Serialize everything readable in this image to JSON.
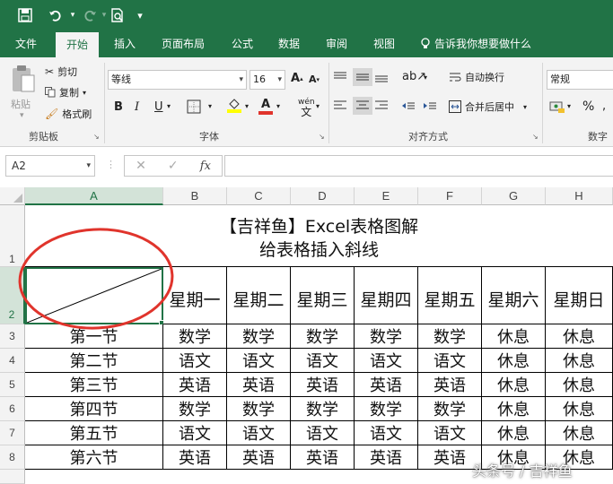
{
  "quick_access": {
    "save_icon": "save-icon",
    "undo_icon": "undo-icon",
    "redo_icon": "redo-icon",
    "preview_icon": "print-preview-icon",
    "customize_icon": "customize-quick-access-icon"
  },
  "tabs": [
    "文件",
    "开始",
    "插入",
    "页面布局",
    "公式",
    "数据",
    "审阅",
    "视图"
  ],
  "tell_me": "告诉我你想要做什么",
  "ribbon": {
    "clipboard": {
      "paste": "粘贴",
      "cut": "剪切",
      "copy": "复制",
      "format_painter": "格式刷",
      "group_label": "剪贴板"
    },
    "font": {
      "font_name": "等线",
      "font_size": "16",
      "bold": "B",
      "italic": "I",
      "underline": "U",
      "phonetic": "wén",
      "group_label": "字体"
    },
    "alignment": {
      "wrap_text": "自动换行",
      "merge_center": "合并后居中",
      "group_label": "对齐方式"
    },
    "number": {
      "format": "常规",
      "percent": "%",
      "group_label": "数字"
    }
  },
  "formula_bar": {
    "name_box": "A2",
    "fx": "fx",
    "content": ""
  },
  "grid": {
    "columns": [
      "A",
      "B",
      "C",
      "D",
      "E",
      "F",
      "G",
      "H"
    ],
    "rows": [
      "1",
      "2",
      "3",
      "4",
      "5",
      "6",
      "7",
      "8"
    ],
    "title_line1": "【吉祥鱼】Excel表格图解",
    "title_line2": "给表格插入斜线",
    "weekdays": [
      "星期一",
      "星期二",
      "星期三",
      "星期四",
      "星期五",
      "星期六",
      "星期日"
    ],
    "schedule": [
      {
        "label": "第一节",
        "cells": [
          "数学",
          "数学",
          "数学",
          "数学",
          "数学",
          "休息",
          "休息"
        ]
      },
      {
        "label": "第二节",
        "cells": [
          "语文",
          "语文",
          "语文",
          "语文",
          "语文",
          "休息",
          "休息"
        ]
      },
      {
        "label": "第三节",
        "cells": [
          "英语",
          "英语",
          "英语",
          "英语",
          "英语",
          "休息",
          "休息"
        ]
      },
      {
        "label": "第四节",
        "cells": [
          "数学",
          "数学",
          "数学",
          "数学",
          "数学",
          "休息",
          "休息"
        ]
      },
      {
        "label": "第五节",
        "cells": [
          "语文",
          "语文",
          "语文",
          "语文",
          "语文",
          "休息",
          "休息"
        ]
      },
      {
        "label": "第六节",
        "cells": [
          "英语",
          "英语",
          "英语",
          "英语",
          "英语",
          "休息",
          "休息"
        ]
      }
    ]
  },
  "watermark": "头条号 / 吉祥鱼",
  "colors": {
    "brand_green": "#217346",
    "annotation_red": "#e0342c"
  }
}
